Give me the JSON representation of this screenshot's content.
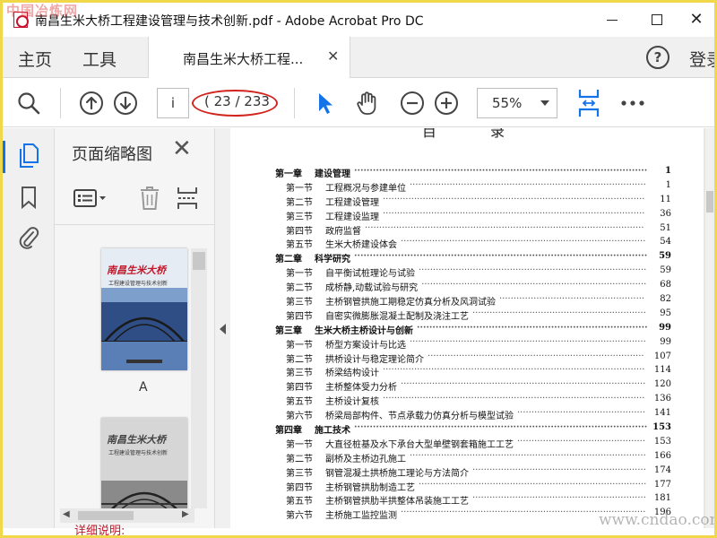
{
  "window": {
    "title": "南昌生米大桥工程建设管理与技术创新.pdf - Adobe Acrobat Pro DC",
    "watermark_tl": "中国冶炼网"
  },
  "menubar": {
    "home": "主页",
    "tools": "工具",
    "doc_tab": "南昌生米大桥工程...",
    "sign_in": "登录"
  },
  "toolbar": {
    "page_input_value": "i",
    "page_count": "( 23 / 233",
    "zoom": "55%",
    "icons": [
      "search-icon",
      "page-up-icon",
      "page-down-icon",
      "select-cursor-icon",
      "hand-tool-icon",
      "zoom-out-icon",
      "zoom-in-icon",
      "fit-page-icon",
      "more-icon"
    ]
  },
  "colors": {
    "accent": "#1473e6",
    "annotation": "#d0241c",
    "frame": "#f0d84a"
  },
  "panel": {
    "title": "页面缩略图",
    "thumb1_title": "南昌生米大桥",
    "thumb1_subtitle": "工程建设管理与技术创新",
    "thumb1_label": "A",
    "thumb2_title": "南昌生米大桥",
    "thumb2_subtitle": "工程建设管理与技术创新"
  },
  "document": {
    "heading": "目录",
    "toc": [
      {
        "kind": "chap",
        "num": "第一章",
        "text": "建设管理",
        "page": "1"
      },
      {
        "kind": "sec",
        "num": "第一节",
        "text": "工程概况与参建单位",
        "page": "1"
      },
      {
        "kind": "sec",
        "num": "第二节",
        "text": "工程建设管理",
        "page": "11"
      },
      {
        "kind": "sec",
        "num": "第三节",
        "text": "工程建设监理",
        "page": "36"
      },
      {
        "kind": "sec",
        "num": "第四节",
        "text": "政府监督",
        "page": "51"
      },
      {
        "kind": "sec",
        "num": "第五节",
        "text": "生米大桥建设体会",
        "page": "54"
      },
      {
        "kind": "chap",
        "num": "第二章",
        "text": "科学研究",
        "page": "59"
      },
      {
        "kind": "sec",
        "num": "第一节",
        "text": "自平衡试桩理论与试验",
        "page": "59"
      },
      {
        "kind": "sec",
        "num": "第二节",
        "text": "成桥静,动载试验与研究",
        "page": "68"
      },
      {
        "kind": "sec",
        "num": "第三节",
        "text": "主桥钢管拱施工期稳定仿真分析及风洞试验",
        "page": "82"
      },
      {
        "kind": "sec",
        "num": "第四节",
        "text": "自密实微膨胀混凝土配制及浇注工艺",
        "page": "95"
      },
      {
        "kind": "chap",
        "num": "第三章",
        "text": "生米大桥主桥设计与创新",
        "page": "99"
      },
      {
        "kind": "sec",
        "num": "第一节",
        "text": "桥型方案设计与比选",
        "page": "99"
      },
      {
        "kind": "sec",
        "num": "第二节",
        "text": "拱桥设计与稳定理论简介",
        "page": "107"
      },
      {
        "kind": "sec",
        "num": "第三节",
        "text": "桥梁结构设计",
        "page": "114"
      },
      {
        "kind": "sec",
        "num": "第四节",
        "text": "主桥整体受力分析",
        "page": "120"
      },
      {
        "kind": "sec",
        "num": "第五节",
        "text": "主桥设计复核",
        "page": "136"
      },
      {
        "kind": "sec",
        "num": "第六节",
        "text": "桥梁局部构件、节点承载力仿真分析与模型试验",
        "page": "141"
      },
      {
        "kind": "chap",
        "num": "第四章",
        "text": "施工技术",
        "page": "153"
      },
      {
        "kind": "sec",
        "num": "第一节",
        "text": "大直径桩基及水下承台大型单壁钢套箱施工工艺",
        "page": "153"
      },
      {
        "kind": "sec",
        "num": "第二节",
        "text": "副桥及主桥边孔施工",
        "page": "166"
      },
      {
        "kind": "sec",
        "num": "第三节",
        "text": "钢管混凝土拱桥施工理论与方法简介",
        "page": "174"
      },
      {
        "kind": "sec",
        "num": "第四节",
        "text": "主桥钢管拱肋制造工艺",
        "page": "177"
      },
      {
        "kind": "sec",
        "num": "第五节",
        "text": "主桥钢管拱肋半拱整体吊装施工工艺",
        "page": "181"
      },
      {
        "kind": "sec",
        "num": "第六节",
        "text": "主桥施工监控监测",
        "page": "196"
      }
    ]
  },
  "footer": {
    "watermark_br": "www.cndao.com",
    "caption": "详细说明:"
  }
}
